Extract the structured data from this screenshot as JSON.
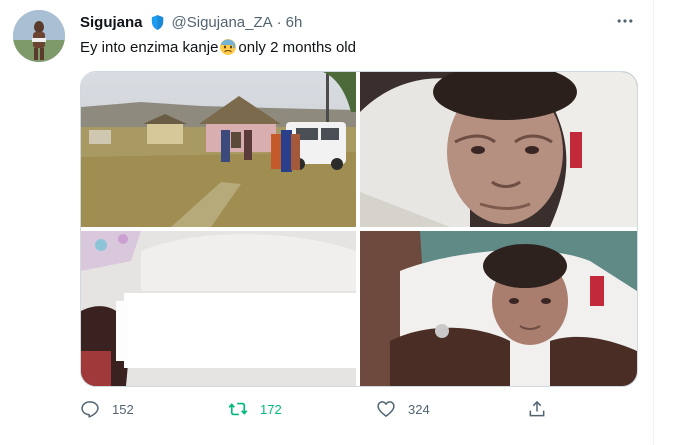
{
  "tweet": {
    "display_name": "Sigujana",
    "handle": "@Sigujana_ZA",
    "separator": "·",
    "time": "6h",
    "text_before_emoji": "Ey into enzima kanje",
    "emoji": "anxious-face-with-sweat",
    "text_after_emoji": "only 2 months old",
    "media": [
      {
        "description": "rural-homestead-with-people-and-white-pickup"
      },
      {
        "description": "infant-wrapped-in-white-blanket"
      },
      {
        "description": "infant-covered-with-blank-white-patch"
      },
      {
        "description": "adult-hands-holding-infant"
      }
    ],
    "actions": {
      "reply_count": "152",
      "retweet_count": "172",
      "like_count": "324"
    }
  },
  "colors": {
    "text": "#0f1419",
    "secondary": "#536471",
    "verified": "#1d9bf0",
    "retweeted": "#00ba7c",
    "border": "#cfd9de"
  },
  "icons": {
    "verified": "verified-badge-icon",
    "more": "more-horizontal-icon",
    "reply": "reply-icon",
    "retweet": "retweet-icon",
    "like": "heart-icon",
    "share": "share-icon"
  }
}
